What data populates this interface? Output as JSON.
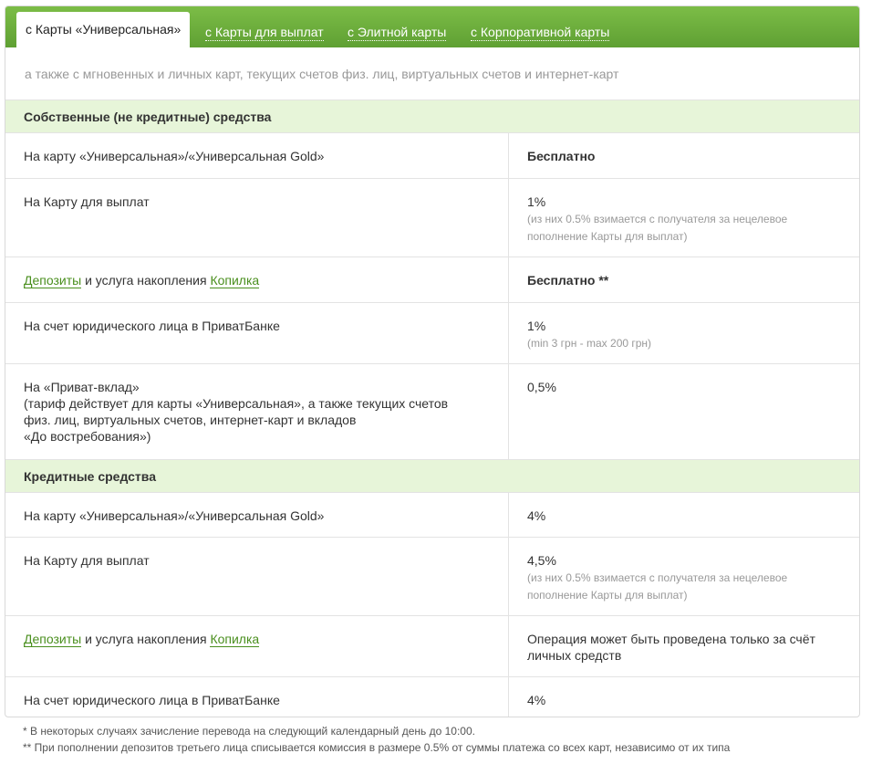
{
  "tabs": [
    {
      "label": "с Карты «Универсальная»",
      "active": true
    },
    {
      "label": "с Карты для выплат",
      "active": false
    },
    {
      "label": "с Элитной карты",
      "active": false
    },
    {
      "label": "с Корпоративной карты",
      "active": false
    }
  ],
  "subtitle": "а также с мгновенных и личных карт, текущих счетов физ. лиц, виртуальных счетов и интернет-карт",
  "sections": {
    "own_title": "Собственные (не кредитные) средства",
    "credit_title": "Кредитные средства"
  },
  "own": [
    {
      "dest": "На карту «Универсальная»/«Универсальная Gold»",
      "value": "Бесплатно"
    },
    {
      "dest": "На Карту для выплат",
      "value": "1%",
      "note": "(из них 0.5% взимается с получателя за нецелевое пополнение Карты для выплат)"
    },
    {
      "dest_link1": "Депозиты",
      "dest_mid": " и услуга накопления ",
      "dest_link2": "Копилка",
      "value": "Бесплатно **"
    },
    {
      "dest": "На счет юридического лица в ПриватБанке",
      "value": "1%",
      "note": "(min 3 грн - max 200 грн)"
    },
    {
      "dest_lines": [
        "На «Приват-вклад»",
        "(тариф действует для карты «Универсальная», а также текущих счетов",
        "физ. лиц, виртуальных счетов, интернет-карт и вкладов",
        "«До востребования»)"
      ],
      "value": "0,5%"
    }
  ],
  "credit": [
    {
      "dest": "На карту «Универсальная»/«Универсальная Gold»",
      "value": "4%"
    },
    {
      "dest": "На Карту для выплат",
      "value": "4,5%",
      "note": "(из них 0.5% взимается с получателя за нецелевое пополнение Карты для выплат)"
    },
    {
      "dest_link1": "Депозиты",
      "dest_mid": " и услуга накопления ",
      "dest_link2": "Копилка",
      "value": "Операция может быть проведена только за счёт личных средств"
    },
    {
      "dest": "На счет юридического лица в ПриватБанке",
      "value": "4%"
    }
  ],
  "footnotes": [
    "* В некоторых случаях зачисление перевода на следующий календарный день до 10:00.",
    "** При пополнении депозитов третьего лица списывается комиссия в размере 0.5% от суммы платежа со всех карт, независимо от их типа"
  ],
  "colors": {
    "tab_bar": "#6aae39",
    "section_bg": "#e7f5d9",
    "link": "#4a8f1e"
  }
}
